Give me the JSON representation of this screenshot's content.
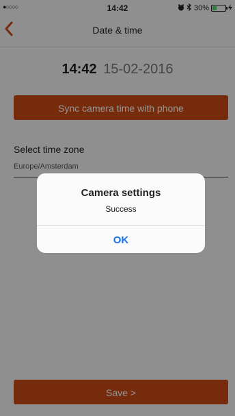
{
  "status_bar": {
    "signal": "●○○○○",
    "time": "14:42",
    "alarm_icon": "alarm-icon",
    "bluetooth_icon": "bluetooth-icon",
    "battery": "30%",
    "battery_level": 0.3,
    "battery_color": "#4cd964"
  },
  "nav": {
    "back_icon": "chevron-left-icon",
    "title": "Date & time"
  },
  "datetime": {
    "time": "14:42",
    "date": "15-02-2016"
  },
  "sync_button": "Sync camera time with phone",
  "timezone": {
    "label": "Select time zone",
    "value": "Europe/Amsterdam"
  },
  "save_button": "Save >",
  "dialog": {
    "title": "Camera settings",
    "message": "Success",
    "ok": "OK"
  },
  "colors": {
    "accent": "#cc4a15",
    "dialog_button": "#1a73e8"
  }
}
